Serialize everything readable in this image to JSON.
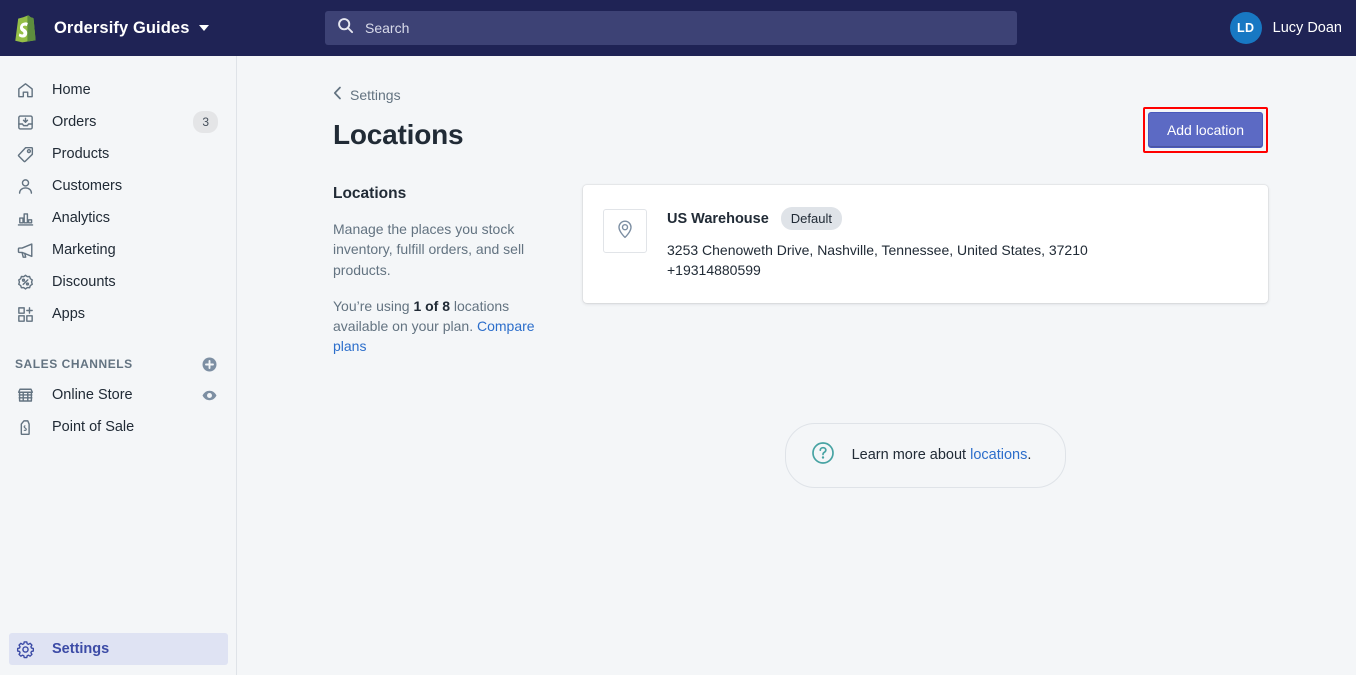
{
  "topbar": {
    "store_name": "Ordersify Guides",
    "logo_icon": "shopify-bag-icon",
    "caret_icon": "chevron-down-icon",
    "search": {
      "placeholder": "Search",
      "value": "",
      "icon": "search-icon"
    },
    "user": {
      "initials": "LD",
      "name": "Lucy Doan"
    },
    "colors": {
      "background": "#1F2355",
      "search_background": "#3D4275",
      "avatar_background": "#1878C3"
    }
  },
  "sidebar": {
    "items": [
      {
        "label": "Home",
        "icon": "home-icon",
        "badge": ""
      },
      {
        "label": "Orders",
        "icon": "orders-inbox-icon",
        "badge": "3"
      },
      {
        "label": "Products",
        "icon": "tag-icon",
        "badge": ""
      },
      {
        "label": "Customers",
        "icon": "person-icon",
        "badge": ""
      },
      {
        "label": "Analytics",
        "icon": "bar-chart-icon",
        "badge": ""
      },
      {
        "label": "Marketing",
        "icon": "megaphone-icon",
        "badge": ""
      },
      {
        "label": "Discounts",
        "icon": "discount-percent-icon",
        "badge": ""
      },
      {
        "label": "Apps",
        "icon": "apps-grid-plus-icon",
        "badge": ""
      }
    ],
    "sales_channels": {
      "title": "SALES CHANNELS",
      "add_icon": "circle-plus-icon",
      "items": [
        {
          "label": "Online Store",
          "icon": "storefront-icon",
          "action_icon": "eye-icon"
        },
        {
          "label": "Point of Sale",
          "icon": "pos-bag-icon",
          "action_icon": ""
        }
      ]
    },
    "settings": {
      "label": "Settings",
      "icon": "gear-icon",
      "active": true,
      "active_background": "#DFE3F3",
      "active_text_color": "#3C4BA6"
    }
  },
  "main": {
    "breadcrumb": {
      "label": "Settings",
      "icon": "chevron-left-icon"
    },
    "page_title": "Locations",
    "add_location_button": {
      "label": "Add location",
      "background": "#5C6AC4",
      "highlight_border": "#FF0000"
    },
    "left_column": {
      "heading": "Locations",
      "description": "Manage the places you stock inventory, fulfill orders, and sell products.",
      "usage_prefix": "You’re using ",
      "usage_count": "1 of 8",
      "usage_suffix": " locations available on your plan. ",
      "compare_link": "Compare plans"
    },
    "location_card": {
      "pin_icon": "map-pin-icon",
      "name": "US Warehouse",
      "badge": "Default",
      "address": "3253 Chenoweth Drive, Nashville, Tennessee, United States, 37210",
      "phone": "+19314880599"
    },
    "help_pill": {
      "icon": "question-circle-icon",
      "icon_color": "#47A3A3",
      "text_prefix": "Learn more about ",
      "link_text": "locations",
      "text_suffix": "."
    }
  }
}
